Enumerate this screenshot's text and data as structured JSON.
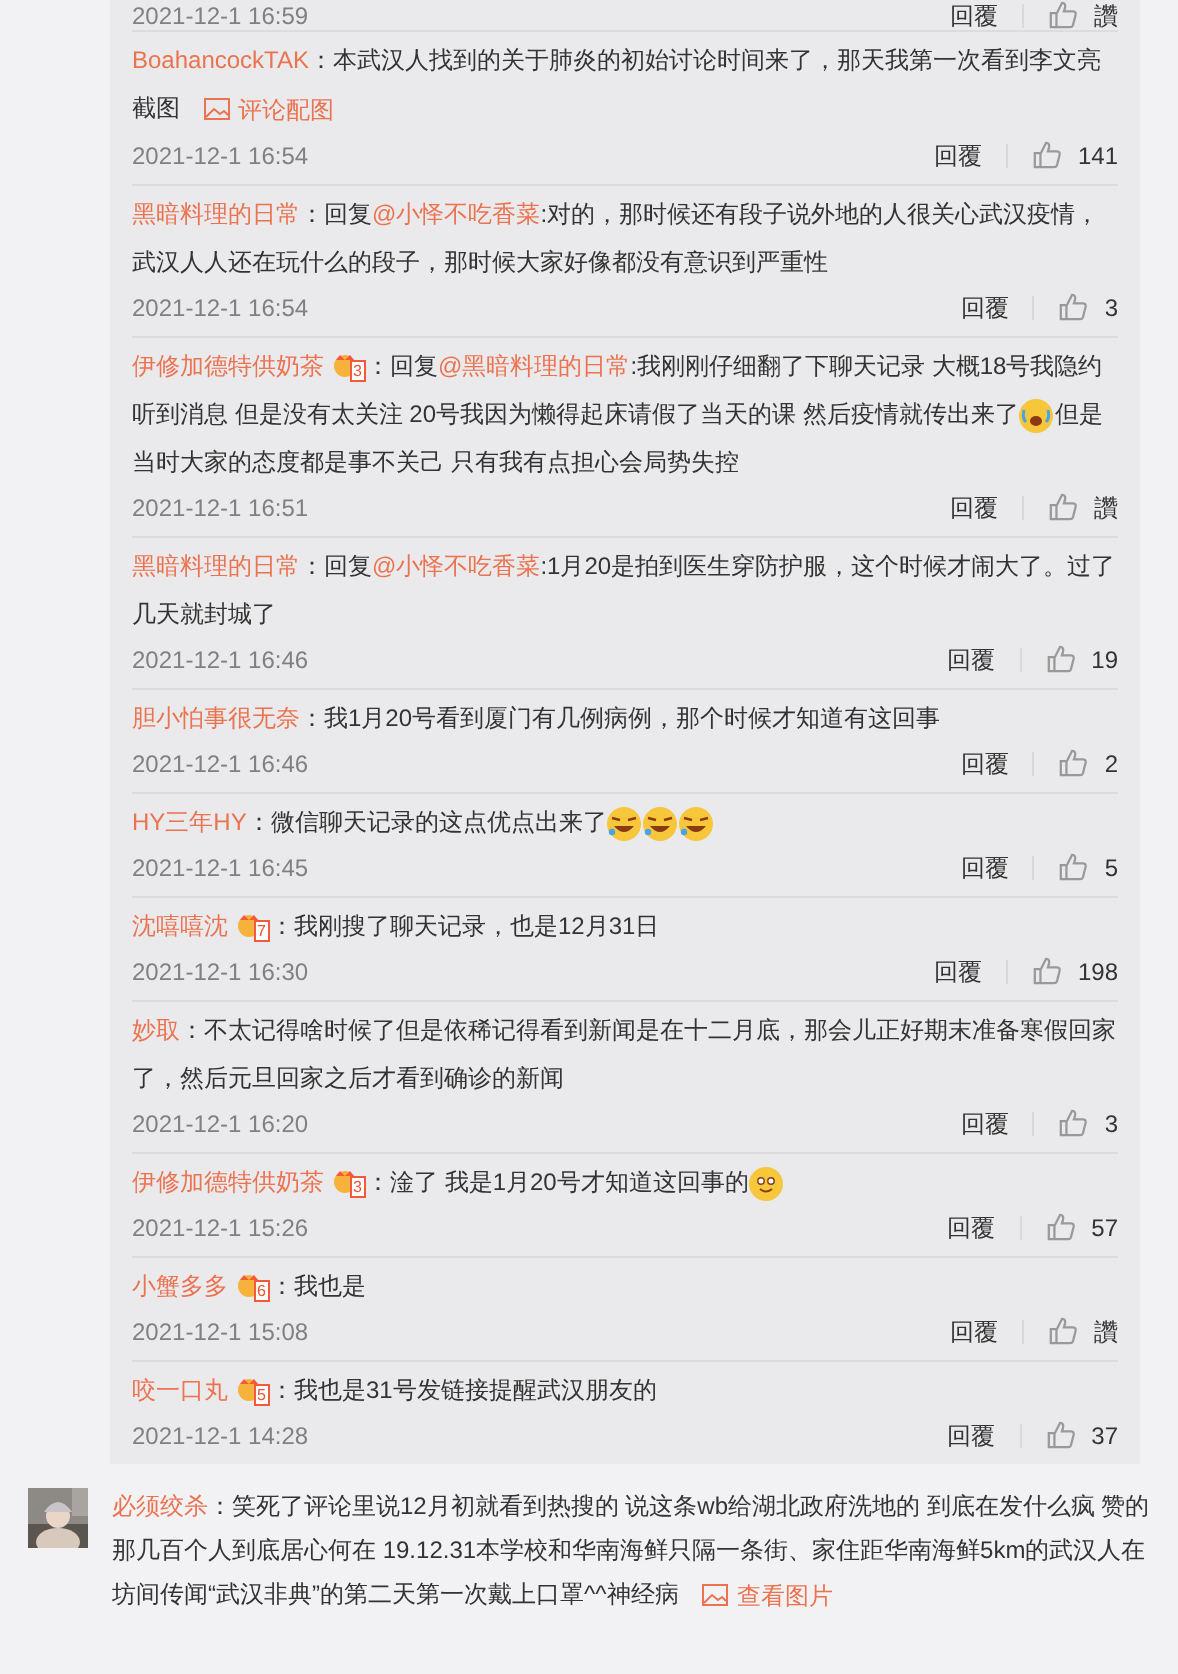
{
  "top_partial": {
    "time": "2021-12-1 16:59",
    "reply": "回覆",
    "likes": "讚"
  },
  "replies": [
    {
      "user": "BoahancockTAK",
      "parts": [
        {
          "kind": "text",
          "text": "：本武汉人找到的关于肺炎的初始讨论时间来了，那天我第一次看到李文亮截图"
        }
      ],
      "image_link": "评论配图",
      "time": "2021-12-1 16:54",
      "reply": "回覆",
      "likes": "141"
    },
    {
      "user": "黑暗料理的日常",
      "parts": [
        {
          "kind": "text",
          "text": "：回复"
        },
        {
          "kind": "mention",
          "text": "@小怿不吃香菜"
        },
        {
          "kind": "text",
          "text": ":对的，那时候还有段子说外地的人很关心武汉疫情，武汉人人还在玩什么的段子，那时候大家好像都没有意识到严重性"
        }
      ],
      "time": "2021-12-1 16:54",
      "reply": "回覆",
      "likes": "3"
    },
    {
      "user": "伊修加德特供奶茶",
      "badge": "3",
      "parts": [
        {
          "kind": "text",
          "text": "：回复"
        },
        {
          "kind": "mention",
          "text": "@黑暗料理的日常"
        },
        {
          "kind": "text",
          "text": ":我刚刚仔细翻了下聊天记录 大概18号我隐约听到消息 但是没有太关注 20号我因为懒得起床请假了当天的课 然后疫情就传出来了"
        },
        {
          "kind": "cry"
        },
        {
          "kind": "text",
          "text": "但是当时大家的态度都是事不关己 只有我有点担心会局势失控"
        }
      ],
      "time": "2021-12-1 16:51",
      "reply": "回覆",
      "likes": "讚"
    },
    {
      "user": "黑暗料理的日常",
      "parts": [
        {
          "kind": "text",
          "text": "：回复"
        },
        {
          "kind": "mention",
          "text": "@小怿不吃香菜"
        },
        {
          "kind": "text",
          "text": ":1月20是拍到医生穿防护服，这个时候才闹大了。过了几天就封城了"
        }
      ],
      "time": "2021-12-1 16:46",
      "reply": "回覆",
      "likes": "19"
    },
    {
      "user": "胆小怕事很无奈",
      "parts": [
        {
          "kind": "text",
          "text": "：我1月20号看到厦门有几例病例，那个时候才知道有这回事"
        }
      ],
      "time": "2021-12-1 16:46",
      "reply": "回覆",
      "likes": "2"
    },
    {
      "user": "HY三年HY",
      "parts": [
        {
          "kind": "text",
          "text": "：微信聊天记录的这点优点出来了"
        },
        {
          "kind": "laugh"
        },
        {
          "kind": "laugh"
        },
        {
          "kind": "laugh"
        }
      ],
      "time": "2021-12-1 16:45",
      "reply": "回覆",
      "likes": "5"
    },
    {
      "user": "沈嘻嘻沈",
      "badge": "7",
      "parts": [
        {
          "kind": "text",
          "text": "：我刚搜了聊天记录，也是12月31日"
        }
      ],
      "time": "2021-12-1 16:30",
      "reply": "回覆",
      "likes": "198"
    },
    {
      "user": "妙取",
      "parts": [
        {
          "kind": "text",
          "text": "：不太记得啥时候了但是依稀记得看到新闻是在十二月底，那会儿正好期末准备寒假回家了，然后元旦回家之后才看到确诊的新闻"
        }
      ],
      "time": "2021-12-1 16:20",
      "reply": "回覆",
      "likes": "3"
    },
    {
      "user": "伊修加德特供奶茶",
      "badge": "3",
      "parts": [
        {
          "kind": "text",
          "text": "：淦了 我是1月20号才知道这回事的"
        },
        {
          "kind": "smile"
        }
      ],
      "time": "2021-12-1 15:26",
      "reply": "回覆",
      "likes": "57"
    },
    {
      "user": "小蟹多多",
      "badge": "6",
      "parts": [
        {
          "kind": "text",
          "text": "：我也是"
        }
      ],
      "time": "2021-12-1 15:08",
      "reply": "回覆",
      "likes": "讚"
    },
    {
      "user": "咬一口丸",
      "badge": "5",
      "parts": [
        {
          "kind": "text",
          "text": "：我也是31号发链接提醒武汉朋友的"
        }
      ],
      "time": "2021-12-1 14:28",
      "reply": "回覆",
      "likes": "37"
    }
  ],
  "comment": {
    "user": "必须绞杀",
    "text": "：笑死了评论里说12月初就看到热搜的 说这条wb给湖北政府洗地的 到底在发什么疯 赞的那几百个人到底居心何在 19.12.31本学校和华南海鲜只隔一条街、家住距华南海鲜5km的武汉人在坊间传闻“武汉非典”的第二天第一次戴上口罩^^神经病",
    "image_link": "查看图片"
  }
}
